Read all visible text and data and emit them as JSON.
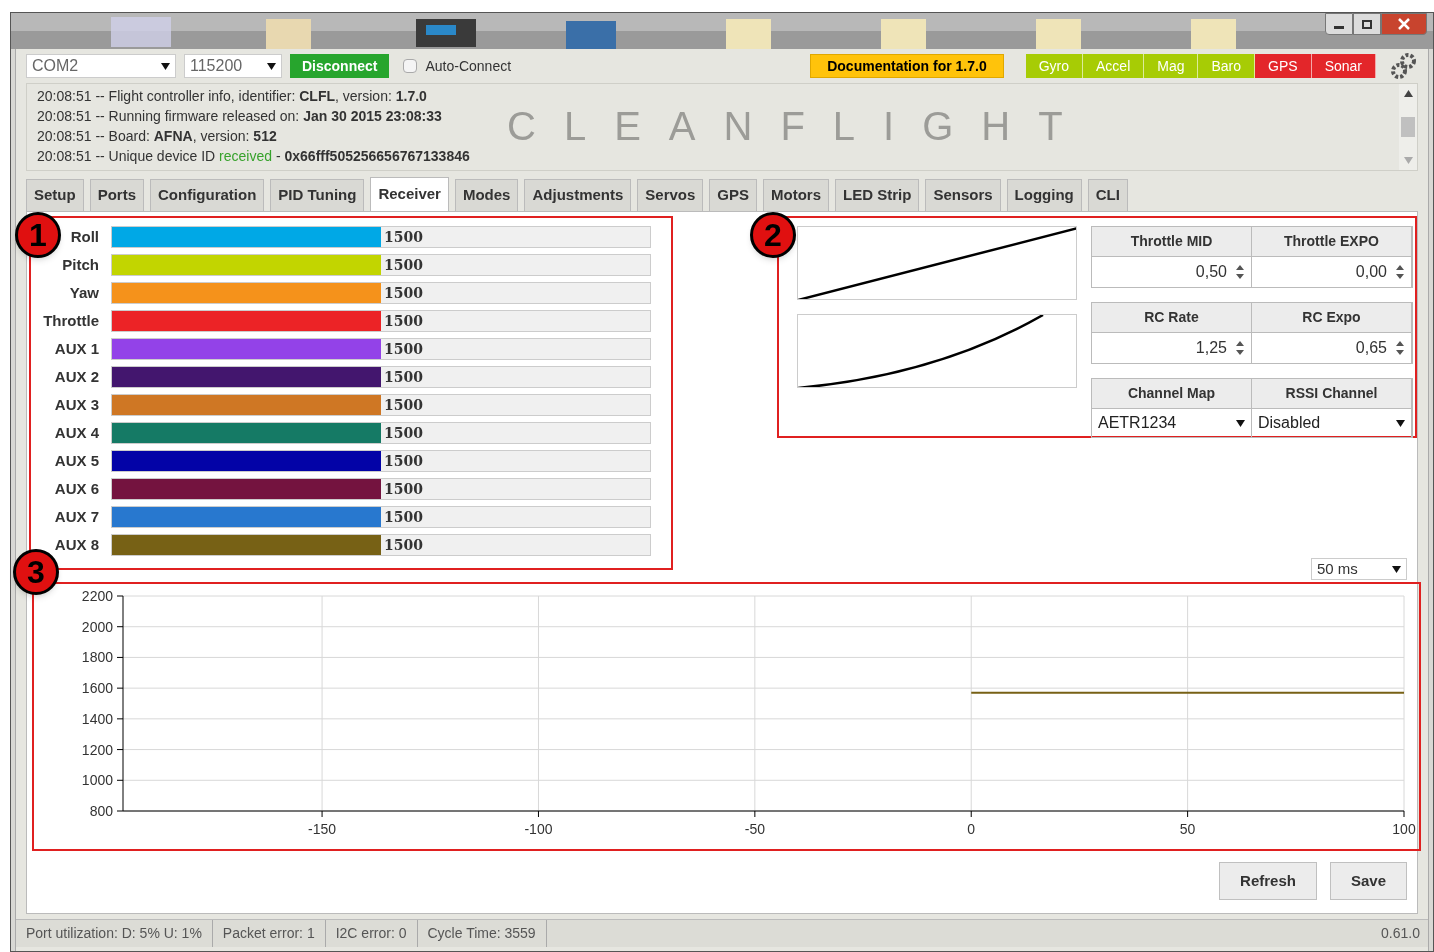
{
  "connection": {
    "port": "COM2",
    "baud": "115200",
    "connect_button": "Disconnect",
    "auto_connect": {
      "label": "Auto-Connect",
      "checked": false
    }
  },
  "documentation_button": "Documentation for 1.7.0",
  "sensors": [
    {
      "label": "Gyro",
      "on": true
    },
    {
      "label": "Accel",
      "on": true
    },
    {
      "label": "Mag",
      "on": true
    },
    {
      "label": "Baro",
      "on": true
    },
    {
      "label": "GPS",
      "on": false
    },
    {
      "label": "Sonar",
      "on": false
    }
  ],
  "log": {
    "logo": "CLEANFLIGHT",
    "lines": [
      [
        {
          "kind": "plain",
          "text": "20:08:51 -- Flight controller info, identifier: "
        },
        {
          "kind": "bold",
          "text": "CLFL"
        },
        {
          "kind": "plain",
          "text": ", version: "
        },
        {
          "kind": "bold",
          "text": "1.7.0"
        }
      ],
      [
        {
          "kind": "plain",
          "text": "20:08:51 -- Running firmware released on: "
        },
        {
          "kind": "bold",
          "text": "Jan 30 2015 23:08:33"
        }
      ],
      [
        {
          "kind": "plain",
          "text": "20:08:51 -- Board: "
        },
        {
          "kind": "bold",
          "text": "AFNA"
        },
        {
          "kind": "plain",
          "text": ", version: "
        },
        {
          "kind": "bold",
          "text": "512"
        }
      ],
      [
        {
          "kind": "plain",
          "text": "20:08:51 -- Unique device ID "
        },
        {
          "kind": "success",
          "text": "received"
        },
        {
          "kind": "plain",
          "text": " - "
        },
        {
          "kind": "bold",
          "text": "0x66fff505256656767133846"
        }
      ]
    ]
  },
  "tabs": [
    {
      "label": "Setup",
      "selected": false
    },
    {
      "label": "Ports",
      "selected": false
    },
    {
      "label": "Configuration",
      "selected": false
    },
    {
      "label": "PID Tuning",
      "selected": false
    },
    {
      "label": "Receiver",
      "selected": true
    },
    {
      "label": "Modes",
      "selected": false
    },
    {
      "label": "Adjustments",
      "selected": false
    },
    {
      "label": "Servos",
      "selected": false
    },
    {
      "label": "GPS",
      "selected": false
    },
    {
      "label": "Motors",
      "selected": false
    },
    {
      "label": "LED Strip",
      "selected": false
    },
    {
      "label": "Sensors",
      "selected": false
    },
    {
      "label": "Logging",
      "selected": false
    },
    {
      "label": "CLI",
      "selected": false
    }
  ],
  "channels": [
    {
      "name": "Roll",
      "level": 0.5,
      "reading": "1500",
      "color": "#00a8e6"
    },
    {
      "name": "Pitch",
      "level": 0.5,
      "reading": "1500",
      "color": "#c2d500"
    },
    {
      "name": "Yaw",
      "level": 0.5,
      "reading": "1500",
      "color": "#f5921b"
    },
    {
      "name": "Throttle",
      "level": 0.5,
      "reading": "1500",
      "color": "#ec2326"
    },
    {
      "name": "AUX 1",
      "level": 0.5,
      "reading": "1500",
      "color": "#9342e8"
    },
    {
      "name": "AUX 2",
      "level": 0.5,
      "reading": "1500",
      "color": "#43166e"
    },
    {
      "name": "AUX 3",
      "level": 0.5,
      "reading": "1500",
      "color": "#cf7724"
    },
    {
      "name": "AUX 4",
      "level": 0.5,
      "reading": "1500",
      "color": "#157a65"
    },
    {
      "name": "AUX 5",
      "level": 0.5,
      "reading": "1500",
      "color": "#0303a7"
    },
    {
      "name": "AUX 6",
      "level": 0.5,
      "reading": "1500",
      "color": "#74133f"
    },
    {
      "name": "AUX 7",
      "level": 0.5,
      "reading": "1500",
      "color": "#2878cf"
    },
    {
      "name": "AUX 8",
      "level": 0.5,
      "reading": "1500",
      "color": "#776115"
    }
  ],
  "tuning": [
    {
      "kind": "number",
      "headers": [
        "Throttle MID",
        "Throttle EXPO"
      ],
      "values": [
        "0,50",
        "0,00"
      ]
    },
    {
      "kind": "number",
      "headers": [
        "RC Rate",
        "RC Expo"
      ],
      "values": [
        "1,25",
        "0,65"
      ]
    },
    {
      "kind": "select",
      "headers": [
        "Channel Map",
        "RSSI Channel"
      ],
      "values": [
        "AETR1234",
        "Disabled"
      ]
    }
  ],
  "refresh_rate": "50 ms",
  "chart": {
    "chart_data": {
      "type": "line",
      "x": [
        0,
        100
      ],
      "series": [
        {
          "color": "#776115",
          "values": [
            1570,
            1570
          ]
        }
      ],
      "xlim": [
        -196,
        100
      ],
      "ylim": [
        800,
        2200
      ],
      "xticks": [
        -150,
        -100,
        -50,
        0,
        50,
        100
      ],
      "yticks": [
        800,
        1000,
        1200,
        1400,
        1600,
        1800,
        2000,
        2200
      ],
      "grid": true
    }
  },
  "annotations": [
    {
      "label": "1"
    },
    {
      "label": "2"
    },
    {
      "label": "3"
    }
  ],
  "buttons": [
    "Refresh",
    "Save"
  ],
  "status_bar": [
    "Port utilization: D: 5% U: 1%",
    "Packet error: 1",
    "I2C error: 0",
    "Cycle Time: 3559"
  ],
  "version": "0.61.0"
}
